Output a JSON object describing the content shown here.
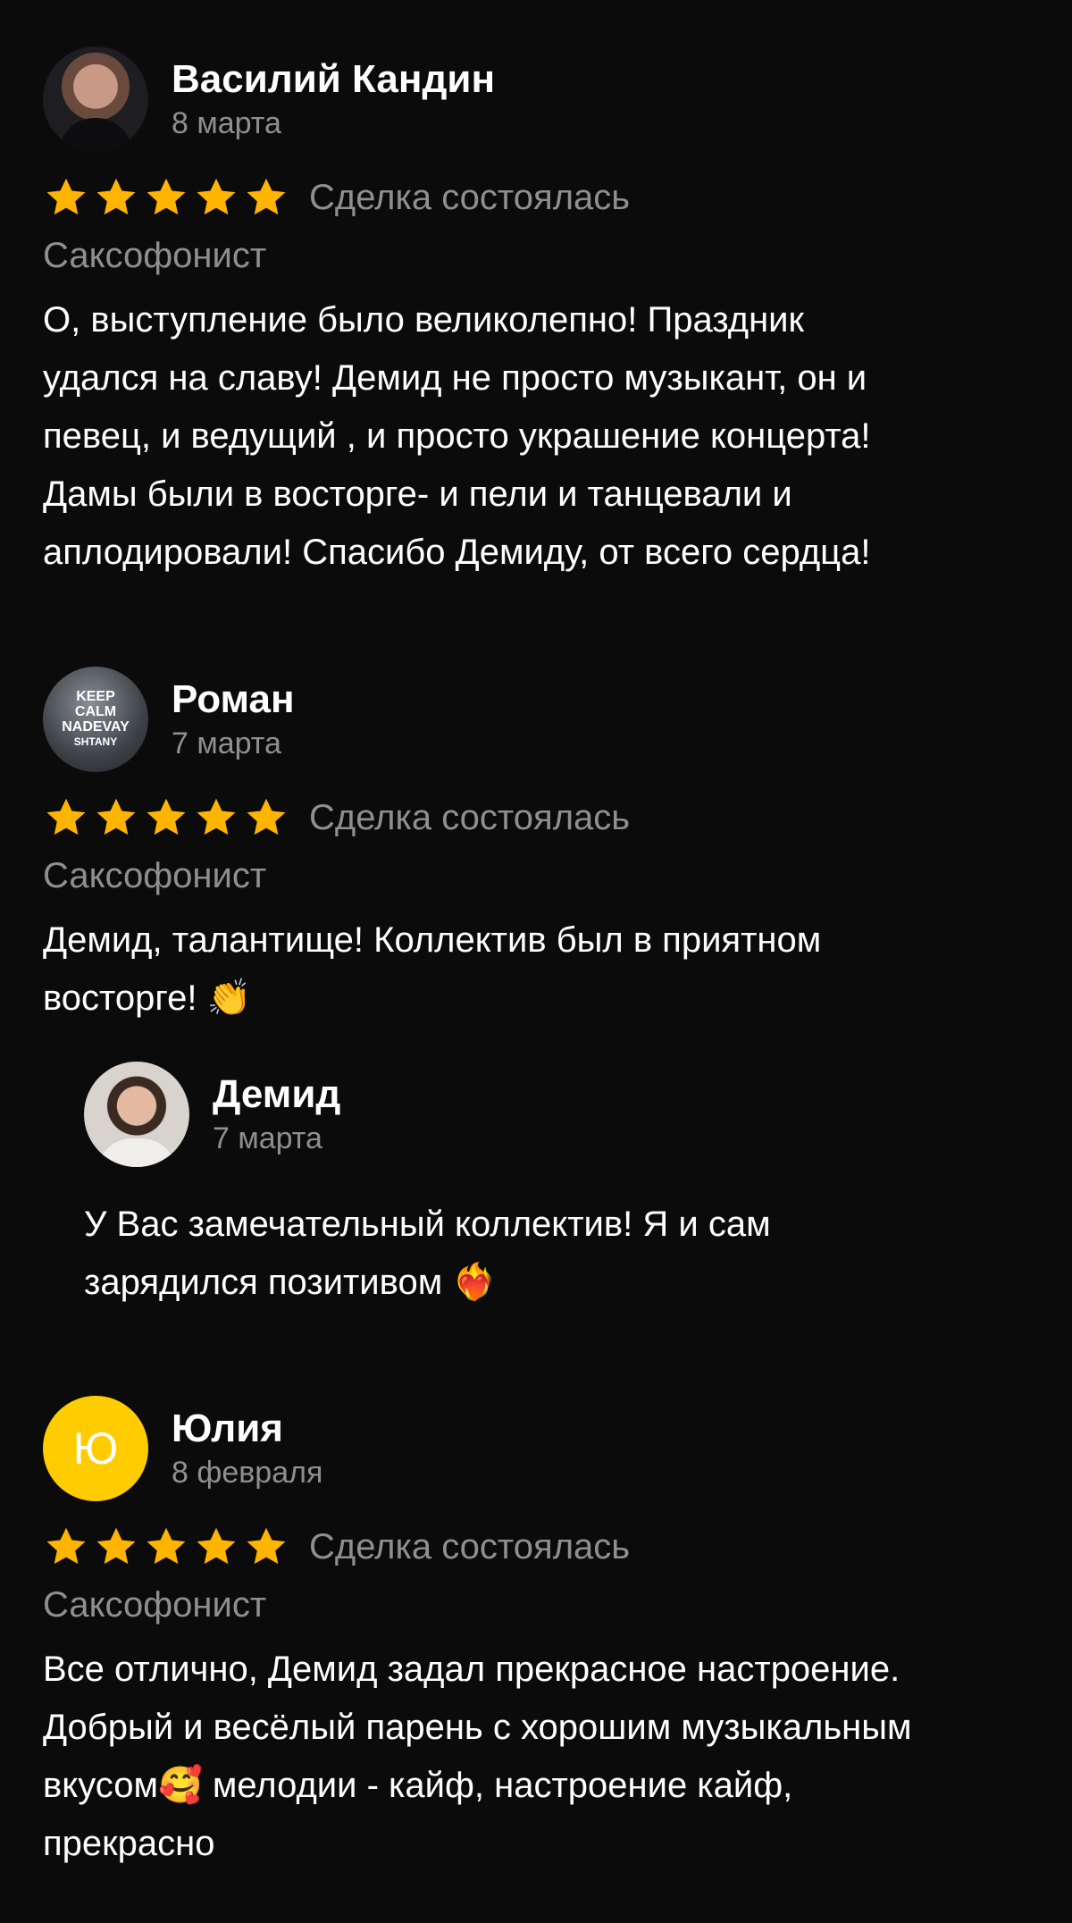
{
  "reviews": [
    {
      "name": "Василий Кандин",
      "date": "8 марта",
      "rating": 5,
      "status": "Сделка состоялась",
      "category": "Саксофонист",
      "text": "О, выступление было великолепно! Праздник\nудался на славу!  Демид не просто музыкант, он и\nпевец, и ведущий , и просто украшение концерта!\nДамы были в восторге- и пели и танцевали и\nаплодировали! Спасибо Демиду, от всего сердца!"
    },
    {
      "name": "Роман",
      "date": "7 марта",
      "rating": 5,
      "status": "Сделка состоялась",
      "category": "Саксофонист",
      "text": "Демид, талантище! Коллектив был в приятном\nвосторге!  👏",
      "avatar_text": [
        "KEEP",
        "CALM",
        "NADEVAY",
        "SHTANY"
      ],
      "reply": {
        "name": "Демид",
        "date": "7 марта",
        "text": "У Вас замечательный коллектив! Я и сам\nзарядился позитивом ❤️‍🔥"
      }
    },
    {
      "name": "Юлия",
      "date": "8 февраля",
      "avatar_letter": "Ю",
      "rating": 5,
      "status": "Сделка состоялась",
      "category": "Саксофонист",
      "text": "Все отлично, Демид задал прекрасное настроение.\nДобрый и весёлый парень с хорошим музыкальным\nвкусом🥰  мелодии - кайф, настроение кайф,\nпрекрасно"
    }
  ],
  "colors": {
    "background": "#0b0b0b",
    "star": "#ffb400",
    "secondary_text": "#8f8f8f",
    "avatar_yellow": "#ffcc00"
  }
}
